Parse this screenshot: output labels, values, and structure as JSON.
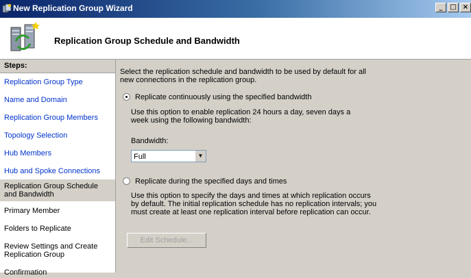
{
  "window": {
    "title": "New Replication Group Wizard",
    "controls": [
      "_",
      "□",
      "×"
    ]
  },
  "header": {
    "title": "Replication Group Schedule and Bandwidth"
  },
  "sidebar": {
    "heading": "Steps:",
    "items": [
      {
        "label": "Replication Group Type",
        "state": "link"
      },
      {
        "label": "Name and Domain",
        "state": "link"
      },
      {
        "label": "Replication Group Members",
        "state": "link"
      },
      {
        "label": "Topology Selection",
        "state": "link"
      },
      {
        "label": "Hub Members",
        "state": "link"
      },
      {
        "label": "Hub and Spoke Connections",
        "state": "link"
      },
      {
        "label": "Replication Group Schedule and Bandwidth",
        "state": "active"
      },
      {
        "label": "Primary Member",
        "state": "plain"
      },
      {
        "label": "Folders to Replicate",
        "state": "plain"
      },
      {
        "label": "Review Settings and Create Replication Group",
        "state": "plain"
      },
      {
        "label": "Confirmation",
        "state": "plain"
      }
    ]
  },
  "main": {
    "intro": "Select the replication schedule and bandwidth to be used by default for all new connections in the replication group.",
    "option1": {
      "label": "Replicate continuously using the specified bandwidth",
      "checked": true,
      "description": "Use this option to enable replication 24 hours a day, seven days a week using the following bandwidth:"
    },
    "bandwidth": {
      "label": "Bandwidth:",
      "value": "Full"
    },
    "option2": {
      "label": "Replicate during the specified days and times",
      "checked": false,
      "description": "Use this option to specify the days and times at which replication occurs by default. The initial replication schedule has no replication intervals; you must create at least one replication interval before replication can occur."
    },
    "edit_schedule_button": "Edit Schedule..."
  }
}
